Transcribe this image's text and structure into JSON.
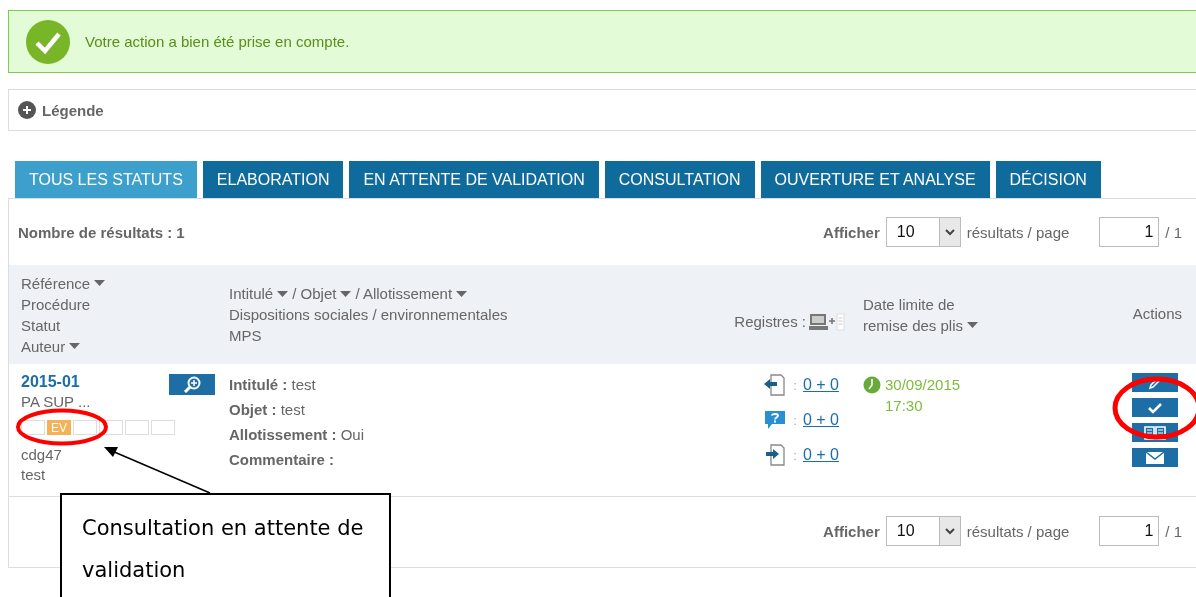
{
  "banner": {
    "message": "Votre action a bien été prise en compte."
  },
  "legend": {
    "label": "Légende",
    "expanded": false
  },
  "tabs": [
    {
      "label": "TOUS LES STATUTS",
      "selected": true
    },
    {
      "label": "ELABORATION",
      "selected": false
    },
    {
      "label": "EN ATTENTE DE VALIDATION",
      "selected": false
    },
    {
      "label": "CONSULTATION",
      "selected": false
    },
    {
      "label": "OUVERTURE ET ANALYSE",
      "selected": false
    },
    {
      "label": "DÉCISION",
      "selected": false
    }
  ],
  "results": {
    "count_label": "Nombre de résultats : 1"
  },
  "pagination_top": {
    "show_label": "Afficher",
    "per_page": "10",
    "per_page_suffix": "résultats / page",
    "page": "1",
    "total": "/ 1"
  },
  "table": {
    "columns": [
      {
        "lines": [
          {
            "text": "Référence",
            "sortable": true
          },
          {
            "text": "Procédure",
            "sortable": false
          },
          {
            "text": "Statut",
            "sortable": false
          },
          {
            "text": "Auteur",
            "sortable": true
          }
        ]
      },
      {
        "lines": [
          {
            "text": "Intitulé",
            "sortable": true
          },
          {
            "text": "/ Objet",
            "sortable": true
          },
          {
            "text": "/ Allotissement",
            "sortable": true
          }
        ],
        "extra_lines": [
          "Dispositions sociales / environnementales",
          "MPS"
        ]
      },
      {
        "label": "Registres :"
      },
      {
        "lines": [
          {
            "text": "Date limite de",
            "sortable": false
          },
          {
            "text": "remise des plis",
            "sortable": true
          }
        ]
      },
      {
        "label": "Actions"
      }
    ],
    "rows": [
      {
        "reference": "2015-01",
        "procedure": "PA SUP ...",
        "status_boxes": [
          {
            "active": false
          },
          {
            "active": true,
            "label": "EV"
          },
          {
            "active": false
          },
          {
            "active": false
          },
          {
            "active": false
          },
          {
            "active": false
          }
        ],
        "author": "cdg47",
        "author_name": "test",
        "details": [
          {
            "label": "Intitulé :",
            "value": "test"
          },
          {
            "label": "Objet :",
            "value": "test"
          },
          {
            "label": "Allotissement :",
            "value": "Oui"
          },
          {
            "label": "Commentaire :"
          }
        ],
        "registers": [
          {
            "kind": "out",
            "separator": ":",
            "value": "0 + 0"
          },
          {
            "kind": "question",
            "separator": ":",
            "value": "0 + 0"
          },
          {
            "kind": "in",
            "separator": ":",
            "value": "0 + 0"
          }
        ],
        "deadline_date": "30/09/2015",
        "deadline_time": "17:30",
        "actions": [
          {
            "kind": "edit"
          },
          {
            "kind": "validate"
          },
          {
            "kind": "read"
          },
          {
            "kind": "mail"
          }
        ]
      }
    ]
  },
  "pagination_bottom": {
    "show_label": "Afficher",
    "per_page": "10",
    "per_page_suffix": "résultats / page",
    "page": "1",
    "total": "/ 1"
  },
  "annotation": {
    "callout_text": "Consultation en attente de validation"
  }
}
